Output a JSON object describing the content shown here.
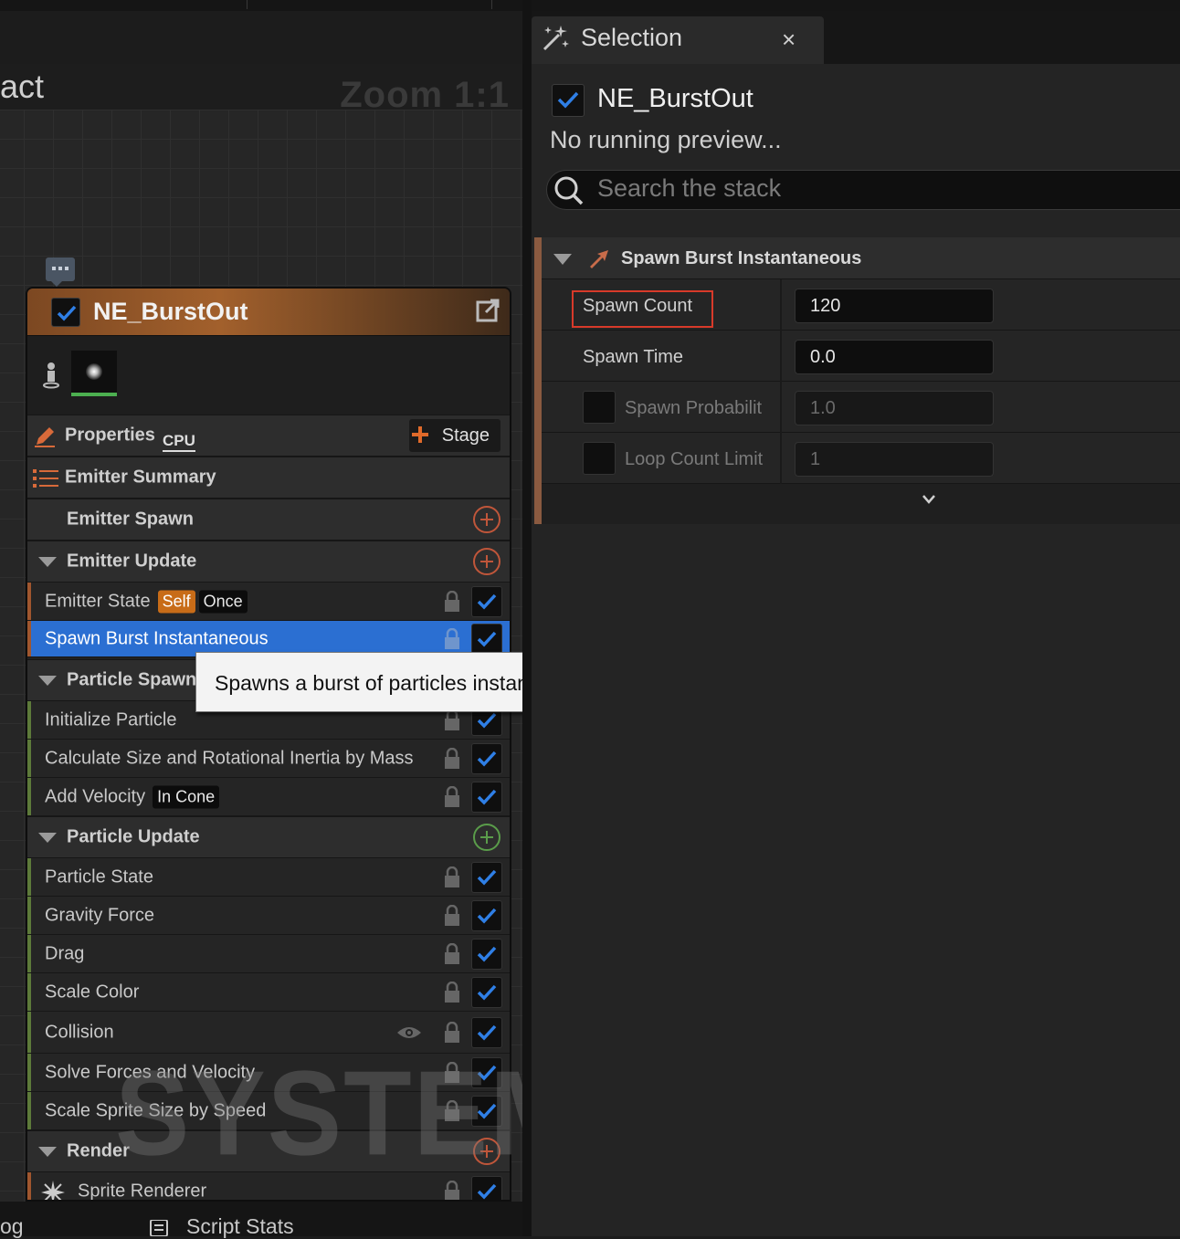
{
  "graph": {
    "title_fragment": "act",
    "zoom": "Zoom 1:1"
  },
  "node": {
    "title": "NE_BurstOut",
    "properties_label": "Properties",
    "cpu_badge": "CPU",
    "stage_button": "Stage",
    "emitter_summary": "Emitter Summary",
    "emitter_spawn": "Emitter Spawn",
    "emitter_update": "Emitter Update",
    "emitter_state": "Emitter State",
    "emitter_state_tag1": "Self",
    "emitter_state_tag2": "Once",
    "spawn_burst": "Spawn Burst Instantaneous",
    "particle_spawn": "Particle Spawn",
    "initialize_particle": "Initialize Particle",
    "calc_size": "Calculate Size and Rotational Inertia by Mass",
    "add_velocity": "Add Velocity",
    "add_velocity_tag": "In Cone",
    "particle_update": "Particle Update",
    "particle_state": "Particle State",
    "gravity_force": "Gravity Force",
    "drag": "Drag",
    "scale_color": "Scale Color",
    "collision": "Collision",
    "solve_forces": "Solve Forces and Velocity",
    "scale_sprite": "Scale Sprite Size by Speed",
    "render": "Render",
    "sprite_renderer": "Sprite Renderer",
    "watermark": "SYSTEM"
  },
  "tooltip": "Spawns a burst of particles instantaneously.",
  "bottom_tabs": [
    "og",
    "Script Stats"
  ],
  "selection": {
    "tab_title": "Selection",
    "close_glyph": "×",
    "emitter_name": "NE_BurstOut",
    "status": "No running preview...",
    "search_placeholder": "Search the stack",
    "module_title": "Spawn Burst Instantaneous",
    "params": [
      {
        "name": "Spawn Count",
        "value": "120"
      },
      {
        "name": "Spawn Time",
        "value": "0.0"
      },
      {
        "name": "Spawn Probabilit",
        "value": "1.0"
      },
      {
        "name": "Loop Count Limit",
        "value": "1"
      }
    ]
  },
  "colors": {
    "accent_orange": "#c86c18",
    "selection_blue": "#2b6fd2",
    "highlight_red": "#d83a2a"
  }
}
